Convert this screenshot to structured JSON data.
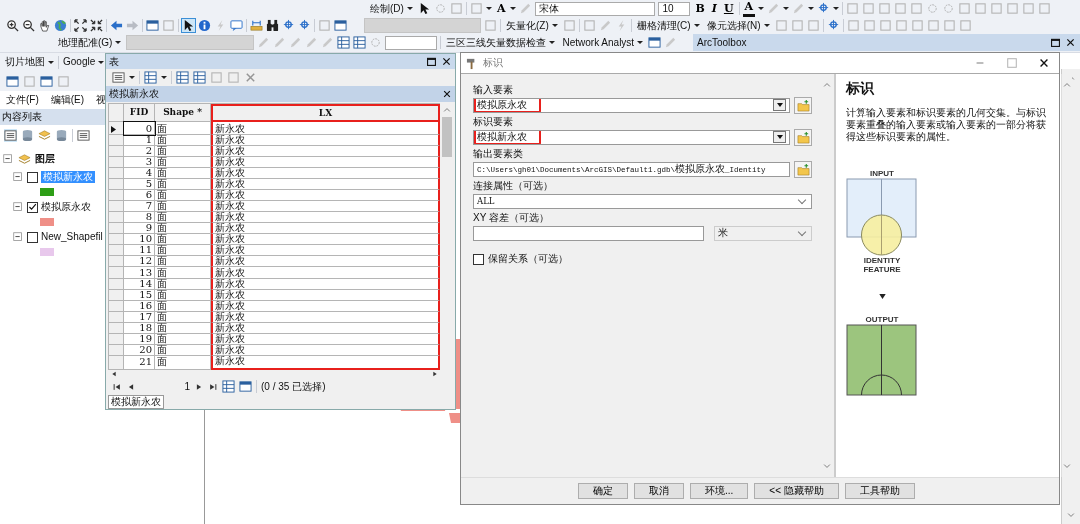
{
  "toolbar": {
    "draw_menu": "绘制(D)",
    "text_tool": "A",
    "font": "宋体",
    "font_size": "10",
    "style_buttons": [
      "B",
      "I",
      "U"
    ],
    "font_color": "A",
    "vectorize_menu": "矢量化(Z)",
    "raster_cleanup_menu": "栅格清理(C)",
    "cell_select_menu": "像元选择(N)",
    "georef_menu": "地理配准(G)",
    "check_menu": "三区三线矢量数据检查",
    "network_menu": "Network Analyst",
    "tile_menu": "切片地图",
    "google_menu": "Google"
  },
  "main_menu": [
    "文件(F)",
    "编辑(E)",
    "视"
  ],
  "toc": {
    "title": "内容列表",
    "root": {
      "label": "图层",
      "expanded": true,
      "children": [
        {
          "label": "模拟新永农",
          "checked": false,
          "selected": true,
          "color": "#2e9e16"
        },
        {
          "label": "模拟原永农",
          "checked": true,
          "selected": false,
          "color": "#ef8f87"
        },
        {
          "label": "New_Shapefil",
          "checked": false,
          "selected": false,
          "color": "#e8c8ec"
        }
      ]
    }
  },
  "table_window": {
    "title": "表",
    "tab_title": "模拟新永农",
    "columns": [
      {
        "label": "FID",
        "highlighted": false
      },
      {
        "label": "Shape *",
        "highlighted": false
      },
      {
        "label": "LX",
        "highlighted": true
      }
    ],
    "rows": [
      {
        "fid": "0",
        "shape": "面",
        "lx": "新永农",
        "current": true
      },
      {
        "fid": "1",
        "shape": "面",
        "lx": "新永农",
        "current": false
      },
      {
        "fid": "2",
        "shape": "面",
        "lx": "新永农",
        "current": false
      },
      {
        "fid": "3",
        "shape": "面",
        "lx": "新永农",
        "current": false
      },
      {
        "fid": "4",
        "shape": "面",
        "lx": "新永农",
        "current": false
      },
      {
        "fid": "5",
        "shape": "面",
        "lx": "新永农",
        "current": false
      },
      {
        "fid": "6",
        "shape": "面",
        "lx": "新永农",
        "current": false
      },
      {
        "fid": "7",
        "shape": "面",
        "lx": "新永农",
        "current": false
      },
      {
        "fid": "8",
        "shape": "面",
        "lx": "新永农",
        "current": false
      },
      {
        "fid": "9",
        "shape": "面",
        "lx": "新永农",
        "current": false
      },
      {
        "fid": "10",
        "shape": "面",
        "lx": "新永农",
        "current": false
      },
      {
        "fid": "11",
        "shape": "面",
        "lx": "新永农",
        "current": false
      },
      {
        "fid": "12",
        "shape": "面",
        "lx": "新永农",
        "current": false
      },
      {
        "fid": "13",
        "shape": "面",
        "lx": "新永农",
        "current": false
      },
      {
        "fid": "14",
        "shape": "面",
        "lx": "新永农",
        "current": false
      },
      {
        "fid": "15",
        "shape": "面",
        "lx": "新永农",
        "current": false
      },
      {
        "fid": "16",
        "shape": "面",
        "lx": "新永农",
        "current": false
      },
      {
        "fid": "17",
        "shape": "面",
        "lx": "新永农",
        "current": false
      },
      {
        "fid": "18",
        "shape": "面",
        "lx": "新永农",
        "current": false
      },
      {
        "fid": "19",
        "shape": "面",
        "lx": "新永农",
        "current": false
      },
      {
        "fid": "20",
        "shape": "面",
        "lx": "新永农",
        "current": false
      },
      {
        "fid": "21",
        "shape": "面",
        "lx": "新永农",
        "current": false
      }
    ],
    "record": "1",
    "selection_status": "(0 / 35 已选择)",
    "bottom_tab": "模拟新永农"
  },
  "arctoolbox": {
    "title": "ArcToolbox"
  },
  "dialog": {
    "title": "标识",
    "fields": [
      {
        "kind": "combo",
        "label": "输入要素",
        "value": "模拟原永农",
        "highlighted": true
      },
      {
        "kind": "combo",
        "label": "标识要素",
        "value": "模拟新永农",
        "highlighted": true
      },
      {
        "kind": "text",
        "label": "输出要素类",
        "value": "C:\\Users\\gh01\\Documents\\ArcGIS\\Default1.gdb\\模拟原永农_Identity"
      },
      {
        "kind": "select",
        "label": "连接属性（可选）",
        "value": "ALL"
      },
      {
        "kind": "xy",
        "label": "XY 容差（可选）",
        "unit": "米"
      },
      {
        "kind": "checkbox",
        "label": "保留关系（可选）",
        "checked": false
      }
    ],
    "help": {
      "title": "标识",
      "text": "计算输入要素和标识要素的几何交集。与标识要素重叠的输入要素或输入要素的一部分将获得这些标识要素的属性。",
      "input_label": "INPUT",
      "identity_label": "IDENTITY FEATURE",
      "output_label": "OUTPUT"
    },
    "buttons": [
      "确定",
      "取消",
      "环境...",
      "<< 隐藏帮助",
      "工具帮助"
    ]
  }
}
